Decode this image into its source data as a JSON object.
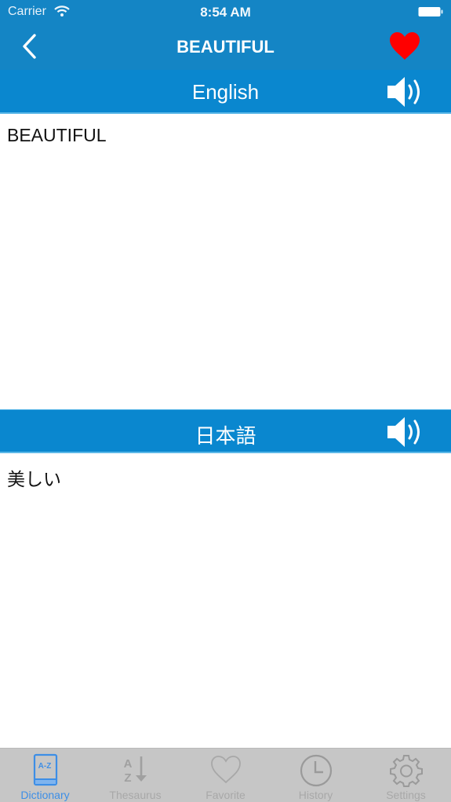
{
  "status_bar": {
    "carrier": "Carrier",
    "time": "8:54 AM",
    "wifi_icon": "wifi-icon",
    "battery_icon": "battery-icon"
  },
  "nav": {
    "title": "BEAUTIFUL",
    "back_icon": "chevron-left-icon",
    "favorite_icon": "heart-icon",
    "favorite_active": true
  },
  "colors": {
    "nav_bg": "#1485c5",
    "section_bg": "#0a87cf",
    "favorite": "#ff0000",
    "tab_active": "#3d8ee6",
    "tab_inactive": "#a8a8a8",
    "tabbar_bg": "#c6c6c6"
  },
  "sections": [
    {
      "language": "English",
      "text": "BEAUTIFUL",
      "speaker_icon": "speaker-icon"
    },
    {
      "language": "日本語",
      "text": "美しい",
      "speaker_icon": "speaker-icon"
    }
  ],
  "tabbar": {
    "active_index": 0,
    "tabs": [
      {
        "label": "Dictionary",
        "icon": "book-az-icon"
      },
      {
        "label": "Thesaurus",
        "icon": "sort-az-icon"
      },
      {
        "label": "Favorite",
        "icon": "heart-outline-icon"
      },
      {
        "label": "History",
        "icon": "clock-icon"
      },
      {
        "label": "Settings",
        "icon": "gear-icon"
      }
    ]
  }
}
